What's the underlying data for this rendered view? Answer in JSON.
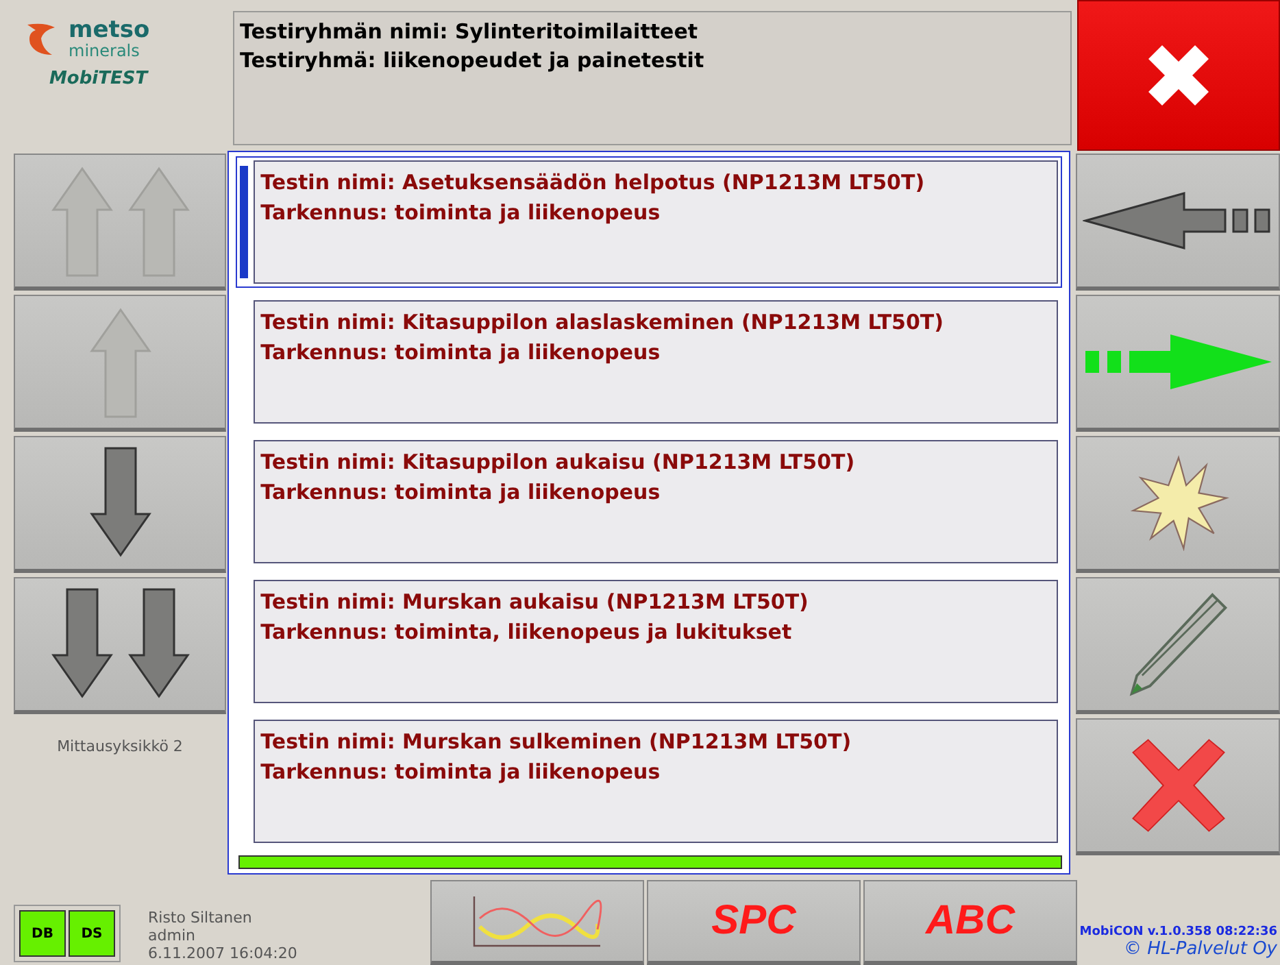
{
  "logo": {
    "brand": "metso",
    "division": "minerals",
    "product": "MobiTEST"
  },
  "header": {
    "lines": [
      "Testiryhmän nimi: Sylinteritoimilaitteet",
      "Testiryhmä: liikenopeudet ja painetestit"
    ]
  },
  "close_button": {
    "kind": "close"
  },
  "nav_buttons": [
    {
      "kind": "page-up",
      "disabled": true
    },
    {
      "kind": "up",
      "disabled": true
    },
    {
      "kind": "down",
      "disabled": false
    },
    {
      "kind": "page-down",
      "disabled": false
    }
  ],
  "unit_label": "Mittausyksikkö 2",
  "tests": [
    {
      "name": "Testin nimi: Asetuksensäädön helpotus (NP1213M LT50T)",
      "detail": "Tarkennus: toiminta ja liikenopeus",
      "selected": true
    },
    {
      "name": "Testin nimi: Kitasuppilon alaslaskeminen (NP1213M LT50T)",
      "detail": "Tarkennus: toiminta ja liikenopeus",
      "selected": false
    },
    {
      "name": "Testin nimi: Kitasuppilon aukaisu (NP1213M LT50T)",
      "detail": "Tarkennus: toiminta ja liikenopeus",
      "selected": false
    },
    {
      "name": "Testin nimi: Murskan aukaisu (NP1213M LT50T)",
      "detail": "Tarkennus: toiminta, liikenopeus ja lukitukset",
      "selected": false
    },
    {
      "name": "Testin nimi: Murskan sulkeminen (NP1213M LT50T)",
      "detail": "Tarkennus: toiminta ja liikenopeus",
      "selected": false
    }
  ],
  "progress": {
    "level": 1
  },
  "action_buttons": [
    {
      "kind": "back"
    },
    {
      "kind": "forward"
    },
    {
      "kind": "new"
    },
    {
      "kind": "edit"
    },
    {
      "kind": "delete"
    }
  ],
  "indicators": [
    {
      "label": "DB",
      "on": true
    },
    {
      "label": "DS",
      "on": true
    }
  ],
  "user": {
    "name": "Risto Siltanen",
    "role": "admin",
    "timestamp": "6.11.2007 16:04:20"
  },
  "bottom_buttons": [
    {
      "kind": "chart"
    },
    {
      "kind": "text",
      "label": "SPC"
    },
    {
      "kind": "text",
      "label": "ABC"
    }
  ],
  "version": "MobiCON v.1.0.358 08:22:36",
  "copyright": "© HL-Palvelut Oy"
}
